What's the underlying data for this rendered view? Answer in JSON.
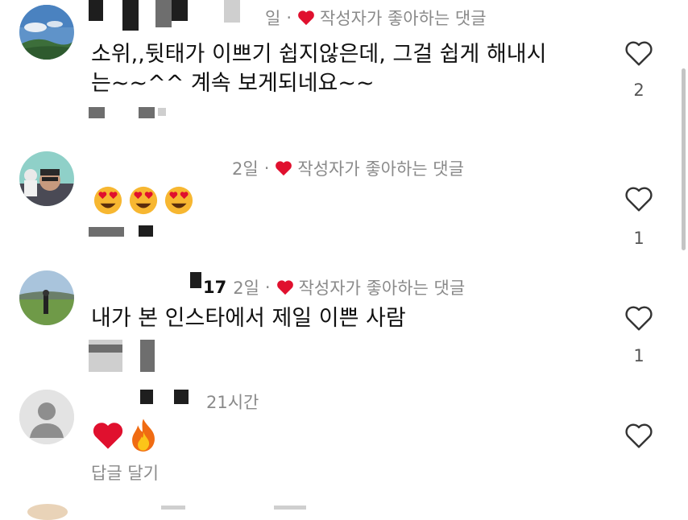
{
  "comments": [
    {
      "time": "일",
      "liked_by_author": "작성자가 좋아하는 댓글",
      "text_line1": "소위,,뒷태가 이쁘기 쉽지않은데, 그걸 쉽게 해내시",
      "text_line2": "는~~^^ 계속 보게되네요~~",
      "likes": "2"
    },
    {
      "time": "2일",
      "liked_by_author": "작성자가 좋아하는 댓글",
      "emoji": "heart-eyes ×3",
      "likes": "1"
    },
    {
      "username_fragment": "17",
      "time": "2일",
      "liked_by_author": "작성자가 좋아하는 댓글",
      "text": "내가 본 인스타에서 제일 이쁜 사람",
      "likes": "1"
    },
    {
      "time": "21시간",
      "emoji": "red heart, fire",
      "reply_label": "답글 달기"
    }
  ],
  "colors": {
    "heart": "#e0102e",
    "meta": "#8a8a8a",
    "text": "#111111"
  },
  "icons": [
    "heart-outline-icon",
    "heart-filled-icon",
    "default-avatar-icon"
  ]
}
